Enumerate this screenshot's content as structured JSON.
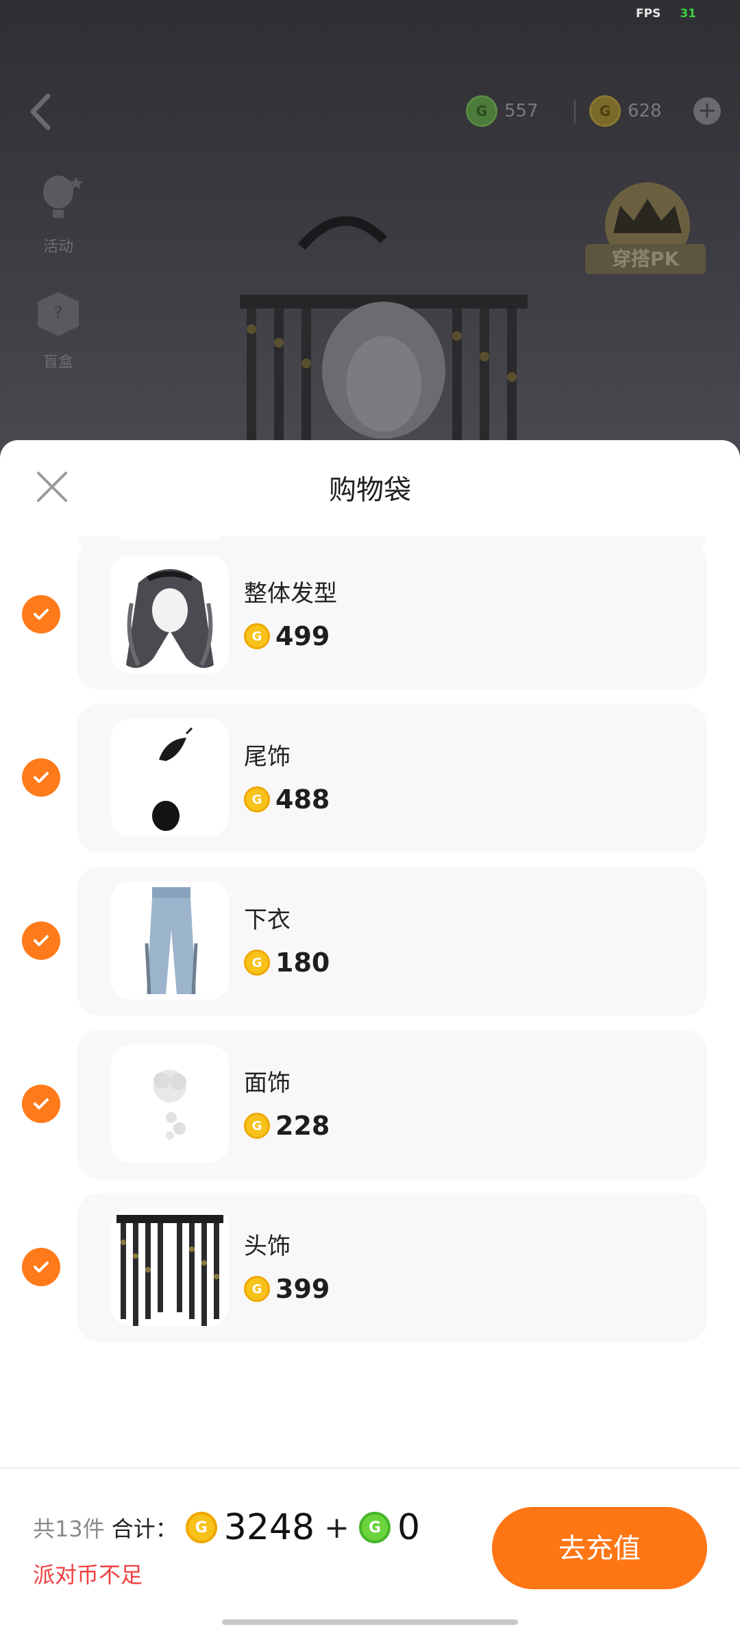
{
  "status": {
    "fps_label": "FPS",
    "fps_value": "31"
  },
  "top_bar": {
    "green_currency": "557",
    "gold_currency": "628"
  },
  "side_entries": [
    {
      "label": "活动",
      "icon": "balloon-icon"
    },
    {
      "label": "盲盒",
      "icon": "mystery-box-icon"
    }
  ],
  "pk_badge": {
    "label": "穿搭PK",
    "icon": "crown-icon"
  },
  "sheet": {
    "title": "购物袋",
    "items": [
      {
        "name": "整体发型",
        "price": "499",
        "checked": true,
        "thumb": "hair-thumbnail"
      },
      {
        "name": "尾饰",
        "price": "488",
        "checked": true,
        "thumb": "tail-accessory-thumbnail"
      },
      {
        "name": "下衣",
        "price": "180",
        "checked": true,
        "thumb": "jeans-thumbnail"
      },
      {
        "name": "面饰",
        "price": "228",
        "checked": true,
        "thumb": "face-accessory-thumbnail"
      },
      {
        "name": "头饰",
        "price": "399",
        "checked": true,
        "thumb": "headpiece-thumbnail"
      }
    ]
  },
  "footer": {
    "count_text": "共13件",
    "total_label": "合计：",
    "gold_total": "3248",
    "plus": "+",
    "green_total": "0",
    "warning": "派对币不足",
    "recharge_label": "去充值"
  },
  "colors": {
    "accent": "#ff7615",
    "warning": "#f04040",
    "gold": "#f8c21a",
    "green": "#6bd33c"
  }
}
